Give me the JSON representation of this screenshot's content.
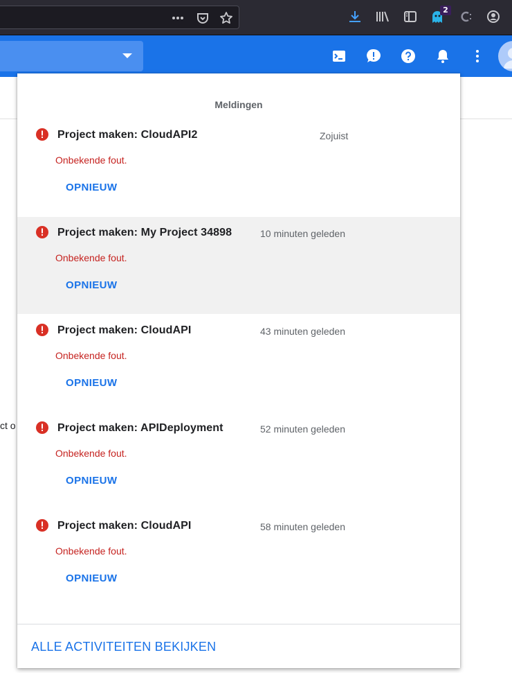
{
  "browser": {
    "toolbar_icons": [
      "more-dots-icon",
      "pocket-icon",
      "bookmark-star-icon",
      "download-icon",
      "library-icon",
      "sidebar-icon",
      "ghost-extension-icon",
      "c-extension-icon",
      "account-icon"
    ],
    "extension_badge": "2"
  },
  "header": {
    "icons": [
      "cloud-shell-icon",
      "feedback-icon",
      "help-icon",
      "notifications-icon",
      "more-vert-icon"
    ]
  },
  "background": {
    "partial_text": "ct o"
  },
  "panel": {
    "title": "Meldingen",
    "notifications": [
      {
        "title": "Project maken: CloudAPI2",
        "time": "Zojuist",
        "message": "Onbekende fout.",
        "action": "OPNIEUW"
      },
      {
        "title": "Project maken: My Project 34898",
        "time": "10 minuten geleden",
        "message": "Onbekende fout.",
        "action": "OPNIEUW"
      },
      {
        "title": "Project maken: CloudAPI",
        "time": "43 minuten geleden",
        "message": "Onbekende fout.",
        "action": "OPNIEUW"
      },
      {
        "title": "Project maken: APIDeployment",
        "time": "52 minuten geleden",
        "message": "Onbekende fout.",
        "action": "OPNIEUW"
      },
      {
        "title": "Project maken: CloudAPI",
        "time": "58 minuten geleden",
        "message": "Onbekende fout.",
        "action": "OPNIEUW"
      }
    ],
    "footer_link": "ALLE ACTIVITEITEN BEKIJKEN"
  },
  "colors": {
    "header_blue": "#1a73e8",
    "error_red": "#d93025",
    "error_text": "#c5221f",
    "link_blue": "#1a73e8"
  }
}
